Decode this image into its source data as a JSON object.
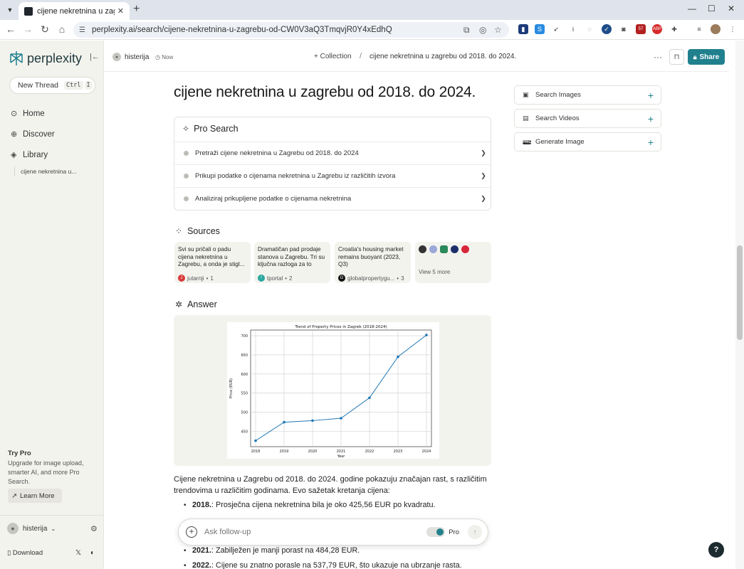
{
  "browser": {
    "tab_title": "cijene nekretnina u zagrebu od",
    "url": "perplexity.ai/search/cijene-nekretnina-u-zagrebu-od-CW0V3aQ3TmqvjR0Y4xEdhQ",
    "ext_badge": "57"
  },
  "sidebar": {
    "brand": "perplexity",
    "new_thread": "New Thread",
    "shortcut_ctrl": "Ctrl",
    "shortcut_key": "I",
    "nav": [
      {
        "label": "Home",
        "icon": "search-icon"
      },
      {
        "label": "Discover",
        "icon": "globe-icon"
      },
      {
        "label": "Library",
        "icon": "library-icon"
      }
    ],
    "library_item": "cijene nekretnina u...",
    "try_pro_title": "Try Pro",
    "try_pro_desc": "Upgrade for image upload, smarter AI, and more Pro Search.",
    "learn_more": "Learn More",
    "username": "histerija",
    "download": "Download"
  },
  "header": {
    "user": "histerija",
    "time": "Now",
    "collection": "Collection",
    "thread_title": "cijene nekretnina u zagrebu od 2018. do 2024.",
    "share": "Share"
  },
  "main": {
    "query_title": "cijene nekretnina u zagrebu od 2018. do 2024.",
    "pro_search_title": "Pro Search",
    "steps": [
      "Pretraži cijene nekretnina u Zagrebu od 2018. do 2024",
      "Prikupi podatke o cijenama nekretnina u Zagrebu iz različitih izvora",
      "Analiziraj prikupljene podatke o cijenama nekretnina"
    ],
    "sources_title": "Sources",
    "sources": [
      {
        "title": "Svi su pričali o padu cijena nekretnina u Zagrebu, a onda je stigl...",
        "site": "jutarnji",
        "num": "1",
        "color": "#d93a3a",
        "letter": "J"
      },
      {
        "title": "Dramatičan pad prodaje stanova u Zagrebu. Tri su ključna razloga za to",
        "site": "tportal",
        "num": "2",
        "color": "#2aa8a0",
        "letter": "!"
      },
      {
        "title": "Croatia's housing market remains buoyant (2023, Q3)",
        "site": "globalpropertygu...",
        "num": "3",
        "color": "#111111",
        "letter": "G"
      }
    ],
    "view_more": "View 5 more",
    "answer_title": "Answer",
    "paragraph": "Cijene nekretnina u Zagrebu od 2018. do 2024. godine pokazuju značajan rast, s različitim trendovima u različitim godinama. Evo sažetak kretanja cijena:",
    "items": [
      {
        "year": "2018.",
        "text": ": Prosječna cijena nekretnina bila je oko 425,56 EUR po kvadratu."
      },
      {
        "year": "2021.",
        "text": ": Zabilježen je manji porast na 484,28 EUR."
      },
      {
        "year": "2022.",
        "text": ": Cijene su znatno porasle na 537,79 EUR, što ukazuje na ubrzanje rasta."
      }
    ]
  },
  "ask": {
    "placeholder": "Ask follow-up",
    "pro_label": "Pro"
  },
  "right": {
    "buttons": [
      "Search Images",
      "Search Videos",
      "Generate Image"
    ]
  },
  "colors": {
    "accent": "#20808d",
    "line": "#1f77b4"
  },
  "chart_data": {
    "type": "line",
    "title": "Trend of Property Prices in Zagreb (2018-2024)",
    "xlabel": "Year",
    "ylabel": "Price (EUR)",
    "x": [
      "2018",
      "2019",
      "2020",
      "2021",
      "2022",
      "2023",
      "2024"
    ],
    "series": [
      {
        "values": [
          425.56,
          474,
          478,
          484.28,
          537.79,
          645,
          702
        ]
      }
    ],
    "ylim": [
      410,
      715
    ],
    "yticks": [
      450,
      500,
      550,
      600,
      650,
      700
    ],
    "grid": true
  }
}
